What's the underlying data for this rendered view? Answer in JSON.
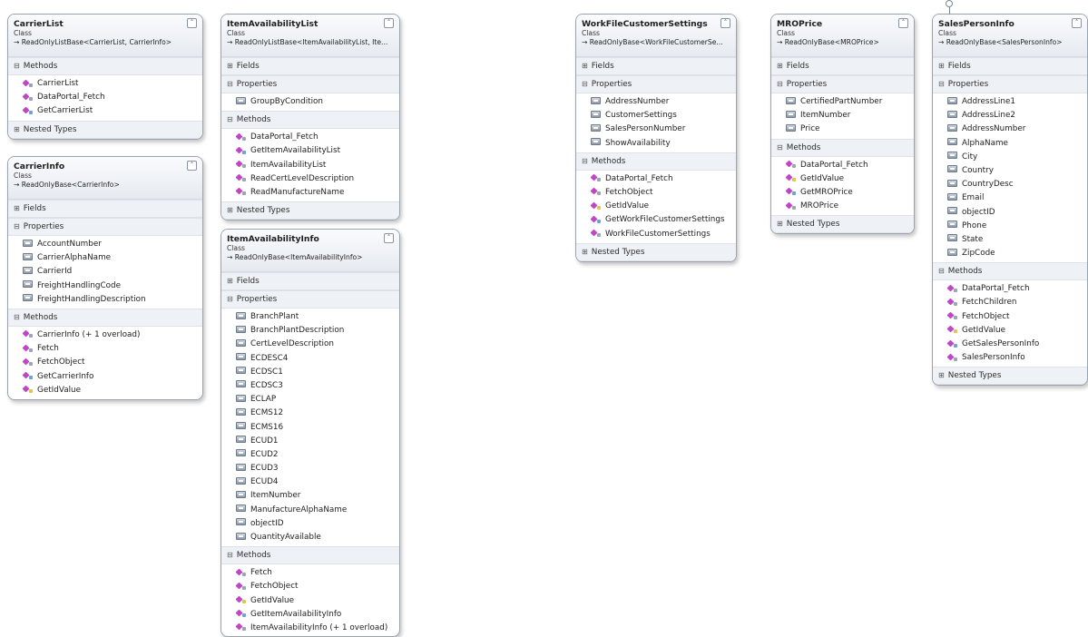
{
  "diagram": {
    "classes": [
      {
        "id": "carrier-list",
        "name": "CarrierList",
        "kind": "Class",
        "base": "ReadOnlyListBase<CarrierList, CarrierInfo>",
        "sections": [
          {
            "label": "Methods",
            "expanded": true,
            "items": [
              {
                "text": "CarrierList",
                "icon": "method"
              },
              {
                "text": "DataPortal_Fetch",
                "icon": "method"
              },
              {
                "text": "GetCarrierList",
                "icon": "static-method"
              }
            ]
          },
          {
            "label": "Nested Types",
            "expanded": false,
            "items": []
          }
        ]
      },
      {
        "id": "carrier-info",
        "name": "CarrierInfo",
        "kind": "Class",
        "base": "ReadOnlyBase<CarrierInfo>",
        "sections": [
          {
            "label": "Fields",
            "expanded": false,
            "items": []
          },
          {
            "label": "Properties",
            "expanded": true,
            "items": [
              {
                "text": "AccountNumber",
                "icon": "property"
              },
              {
                "text": "CarrierAlphaName",
                "icon": "property"
              },
              {
                "text": "CarrierId",
                "icon": "property"
              },
              {
                "text": "FreightHandlingCode",
                "icon": "property"
              },
              {
                "text": "FreightHandlingDescription",
                "icon": "property"
              }
            ]
          },
          {
            "label": "Methods",
            "expanded": true,
            "items": [
              {
                "text": "CarrierInfo (+ 1 overload)",
                "icon": "method"
              },
              {
                "text": "Fetch",
                "icon": "method"
              },
              {
                "text": "FetchObject",
                "icon": "method"
              },
              {
                "text": "GetCarrierInfo",
                "icon": "static-method"
              },
              {
                "text": "GetIdValue",
                "icon": "protected-method"
              }
            ]
          }
        ]
      },
      {
        "id": "item-availability-list",
        "name": "ItemAvailabilityList",
        "kind": "Class",
        "base": "ReadOnlyListBase<ItemAvailabilityList, Ite...",
        "sections": [
          {
            "label": "Fields",
            "expanded": false,
            "items": []
          },
          {
            "label": "Properties",
            "expanded": true,
            "items": [
              {
                "text": "GroupByCondition",
                "icon": "property"
              }
            ]
          },
          {
            "label": "Methods",
            "expanded": true,
            "items": [
              {
                "text": "DataPortal_Fetch",
                "icon": "method"
              },
              {
                "text": "GetItemAvailabilityList",
                "icon": "static-method"
              },
              {
                "text": "ItemAvailabilityList",
                "icon": "method"
              },
              {
                "text": "ReadCertLevelDescription",
                "icon": "method"
              },
              {
                "text": "ReadManufactureName",
                "icon": "method"
              }
            ]
          },
          {
            "label": "Nested Types",
            "expanded": false,
            "items": []
          }
        ]
      },
      {
        "id": "item-availability-info",
        "name": "ItemAvailabilityInfo",
        "kind": "Class",
        "base": "ReadOnlyBase<ItemAvailabilityInfo>",
        "sections": [
          {
            "label": "Fields",
            "expanded": false,
            "items": []
          },
          {
            "label": "Properties",
            "expanded": true,
            "items": [
              {
                "text": "BranchPlant",
                "icon": "property"
              },
              {
                "text": "BranchPlantDescription",
                "icon": "property"
              },
              {
                "text": "CertLevelDescription",
                "icon": "property"
              },
              {
                "text": "ECDESC4",
                "icon": "property"
              },
              {
                "text": "ECDSC1",
                "icon": "property"
              },
              {
                "text": "ECDSC3",
                "icon": "property"
              },
              {
                "text": "ECLAP",
                "icon": "property"
              },
              {
                "text": "ECMS12",
                "icon": "property"
              },
              {
                "text": "ECMS16",
                "icon": "property"
              },
              {
                "text": "ECUD1",
                "icon": "property"
              },
              {
                "text": "ECUD2",
                "icon": "property"
              },
              {
                "text": "ECUD3",
                "icon": "property"
              },
              {
                "text": "ECUD4",
                "icon": "property"
              },
              {
                "text": "ItemNumber",
                "icon": "property"
              },
              {
                "text": "ManufactureAlphaName",
                "icon": "property"
              },
              {
                "text": "objectID",
                "icon": "property"
              },
              {
                "text": "QuantityAvailable",
                "icon": "property"
              }
            ]
          },
          {
            "label": "Methods",
            "expanded": true,
            "items": [
              {
                "text": "Fetch",
                "icon": "method"
              },
              {
                "text": "FetchObject",
                "icon": "method"
              },
              {
                "text": "GetIdValue",
                "icon": "protected-method"
              },
              {
                "text": "GetItemAvailabilityInfo",
                "icon": "static-method"
              },
              {
                "text": "ItemAvailabilityInfo (+ 1 overload)",
                "icon": "method"
              }
            ]
          }
        ]
      },
      {
        "id": "work-file-customer-settings",
        "name": "WorkFileCustomerSettings",
        "kind": "Class",
        "base": "ReadOnlyBase<WorkFileCustomerSe...",
        "sections": [
          {
            "label": "Fields",
            "expanded": false,
            "items": []
          },
          {
            "label": "Properties",
            "expanded": true,
            "items": [
              {
                "text": "AddressNumber",
                "icon": "property"
              },
              {
                "text": "CustomerSettings",
                "icon": "property"
              },
              {
                "text": "SalesPersonNumber",
                "icon": "property"
              },
              {
                "text": "ShowAvailability",
                "icon": "property"
              }
            ]
          },
          {
            "label": "Methods",
            "expanded": true,
            "items": [
              {
                "text": "DataPortal_Fetch",
                "icon": "method"
              },
              {
                "text": "FetchObject",
                "icon": "method"
              },
              {
                "text": "GetIdValue",
                "icon": "protected-method"
              },
              {
                "text": "GetWorkFileCustomerSettings",
                "icon": "static-method"
              },
              {
                "text": "WorkFileCustomerSettings",
                "icon": "method"
              }
            ]
          },
          {
            "label": "Nested Types",
            "expanded": false,
            "items": []
          }
        ]
      },
      {
        "id": "mro-price",
        "name": "MROPrice",
        "kind": "Class",
        "base": "ReadOnlyBase<MROPrice>",
        "sections": [
          {
            "label": "Fields",
            "expanded": false,
            "items": []
          },
          {
            "label": "Properties",
            "expanded": true,
            "items": [
              {
                "text": "CertifiedPartNumber",
                "icon": "property"
              },
              {
                "text": "ItemNumber",
                "icon": "property"
              },
              {
                "text": "Price",
                "icon": "property"
              }
            ]
          },
          {
            "label": "Methods",
            "expanded": true,
            "items": [
              {
                "text": "DataPortal_Fetch",
                "icon": "method"
              },
              {
                "text": "GetIdValue",
                "icon": "protected-method"
              },
              {
                "text": "GetMROPrice",
                "icon": "static-method"
              },
              {
                "text": "MROPrice",
                "icon": "method"
              }
            ]
          },
          {
            "label": "Nested Types",
            "expanded": false,
            "items": []
          }
        ]
      },
      {
        "id": "sales-person-info",
        "name": "SalesPersonInfo",
        "kind": "Class",
        "base": "ReadOnlyBase<SalesPersonInfo>",
        "sections": [
          {
            "label": "Fields",
            "expanded": false,
            "items": []
          },
          {
            "label": "Properties",
            "expanded": true,
            "items": [
              {
                "text": "AddressLine1",
                "icon": "property"
              },
              {
                "text": "AddressLine2",
                "icon": "property"
              },
              {
                "text": "AddressNumber",
                "icon": "property"
              },
              {
                "text": "AlphaName",
                "icon": "property"
              },
              {
                "text": "City",
                "icon": "property"
              },
              {
                "text": "Country",
                "icon": "property"
              },
              {
                "text": "CountryDesc",
                "icon": "property"
              },
              {
                "text": "Email",
                "icon": "property"
              },
              {
                "text": "objectID",
                "icon": "property"
              },
              {
                "text": "Phone",
                "icon": "property"
              },
              {
                "text": "State",
                "icon": "property"
              },
              {
                "text": "ZipCode",
                "icon": "property"
              }
            ]
          },
          {
            "label": "Methods",
            "expanded": true,
            "items": [
              {
                "text": "DataPortal_Fetch",
                "icon": "method"
              },
              {
                "text": "FetchChildren",
                "icon": "method"
              },
              {
                "text": "FetchObject",
                "icon": "method"
              },
              {
                "text": "GetIdValue",
                "icon": "protected-method"
              },
              {
                "text": "GetSalesPersonInfo",
                "icon": "static-method"
              },
              {
                "text": "SalesPersonInfo",
                "icon": "method"
              }
            ]
          },
          {
            "label": "Nested Types",
            "expanded": false,
            "items": []
          }
        ]
      }
    ]
  }
}
